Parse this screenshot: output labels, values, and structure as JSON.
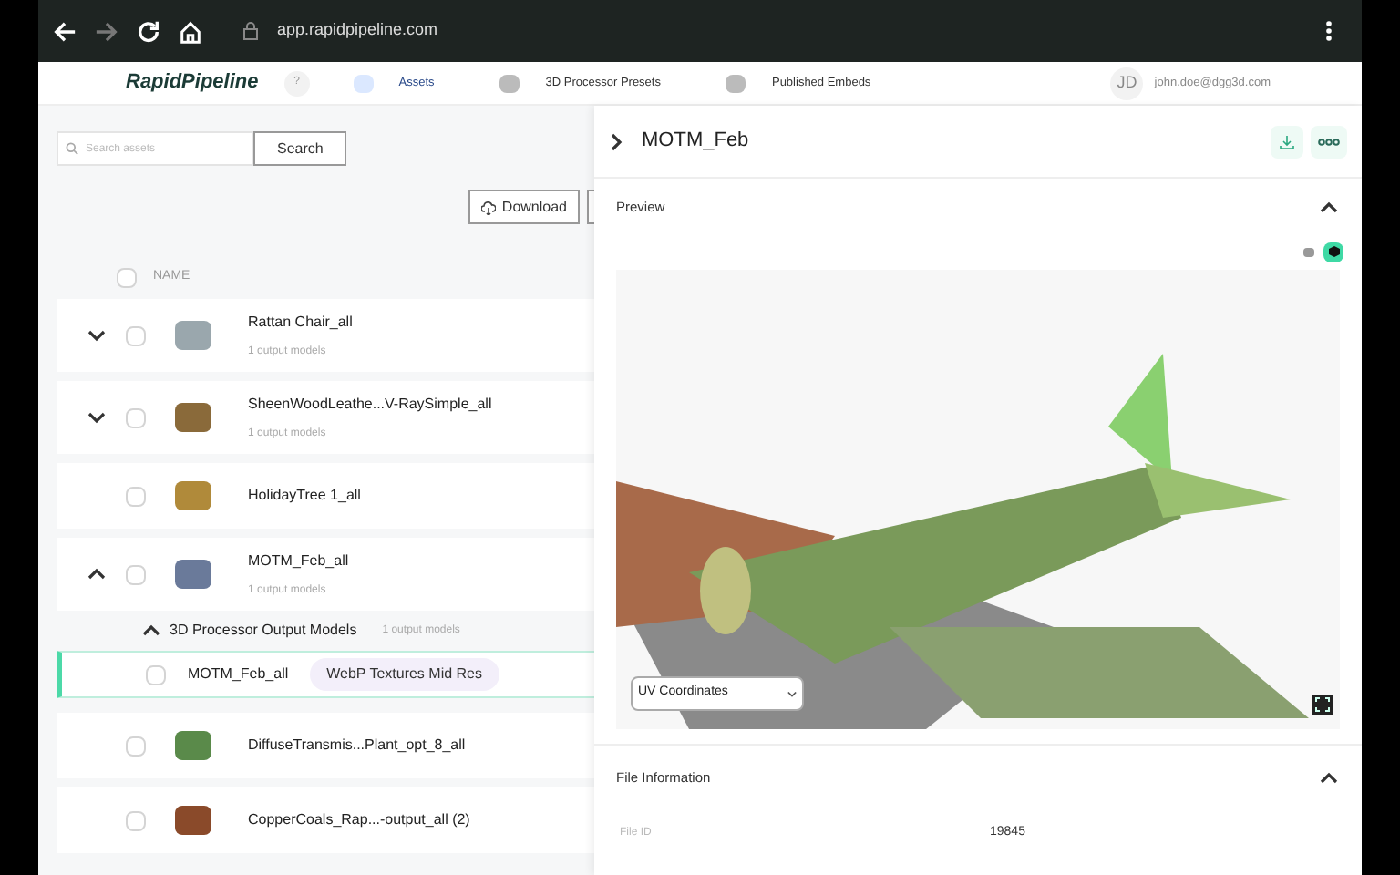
{
  "browser": {
    "url": "app.rapidpipeline.com"
  },
  "header": {
    "logo": "RapidPipeline",
    "help": "?",
    "nav": [
      {
        "label": "Assets",
        "selected": true
      },
      {
        "label": "3D Processor Presets",
        "selected": false
      },
      {
        "label": "Published Embeds",
        "selected": false
      }
    ],
    "user": {
      "initials": "JD",
      "email": "john.doe@dgg3d.com"
    }
  },
  "assets": {
    "search": {
      "placeholder": "Search assets",
      "button": "Search"
    },
    "download_button": "Download",
    "column": "NAME",
    "select_all_checked": false,
    "items": [
      {
        "name": "Rattan Chair_all",
        "subtitle": "1 output models",
        "expanded": false,
        "checked": false
      },
      {
        "name": "SheenWoodLeathe...V-RaySimple_all",
        "subtitle": "1 output models",
        "expanded": false,
        "checked": false
      },
      {
        "name": "HolidayTree 1_all",
        "checked": false
      },
      {
        "name": "MOTM_Feb_all",
        "subtitle": "1 output models",
        "expanded": true,
        "checked": false,
        "group": {
          "title": "3D Processor Output Models",
          "count": "1 output models",
          "expanded": true,
          "rows": [
            {
              "name": "MOTM_Feb_all",
              "tag": "WebP Textures Mid Res",
              "selected": true,
              "checked": false
            }
          ]
        }
      },
      {
        "name": "DiffuseTransmis...Plant_opt_8_all",
        "checked": false
      },
      {
        "name": "CopperCoals_Rap...-output_all (2)",
        "checked": false
      }
    ]
  },
  "detail": {
    "title": "MOTM_Feb",
    "preview": {
      "title": "Preview",
      "expanded": true,
      "views": [
        {
          "kind": "box",
          "selected": false
        },
        {
          "kind": "cube",
          "selected": true
        }
      ],
      "mode": "UV Coordinates"
    },
    "file_info": {
      "title": "File Information",
      "expanded": true,
      "rows": [
        {
          "label": "File ID",
          "value": "19845"
        }
      ]
    }
  }
}
